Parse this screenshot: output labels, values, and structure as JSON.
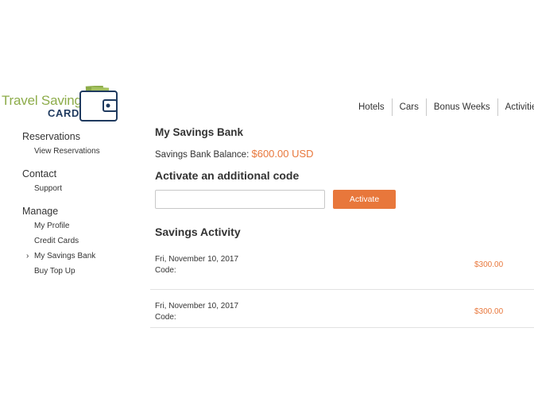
{
  "logo": {
    "line1": "Travel Savings",
    "line2": "CARD",
    "icon": "wallet-icon",
    "colors": {
      "green": "#8dac4a",
      "navy": "#1f3a5f"
    }
  },
  "topnav": {
    "items": [
      "Hotels",
      "Cars",
      "Bonus Weeks",
      "Activities"
    ]
  },
  "sidebar": {
    "groups": [
      {
        "heading": "Reservations",
        "links": [
          "View Reservations"
        ]
      },
      {
        "heading": "Contact",
        "links": [
          "Support"
        ]
      },
      {
        "heading": "Manage",
        "links": [
          "My Profile",
          "Credit Cards",
          "My Savings Bank",
          "Buy Top Up"
        ]
      }
    ],
    "active_link": "My Savings Bank",
    "active_icon": "chevron-right-icon"
  },
  "main": {
    "title": "My Savings Bank",
    "balance_label": "Savings Bank Balance:",
    "balance_value": "$600.00 USD",
    "activate_title": "Activate an additional code",
    "code_input_value": "",
    "activate_button": "Activate",
    "activity_title": "Savings Activity",
    "activity": [
      {
        "date": "Fri, November 10, 2017",
        "code_label": "Code:",
        "amount": "$300.00"
      },
      {
        "date": "Fri, November 10, 2017",
        "code_label": "Code:",
        "amount": "$300.00"
      }
    ]
  },
  "colors": {
    "accent": "#e8773b",
    "text": "#333333",
    "border": "#c8c8c8"
  }
}
